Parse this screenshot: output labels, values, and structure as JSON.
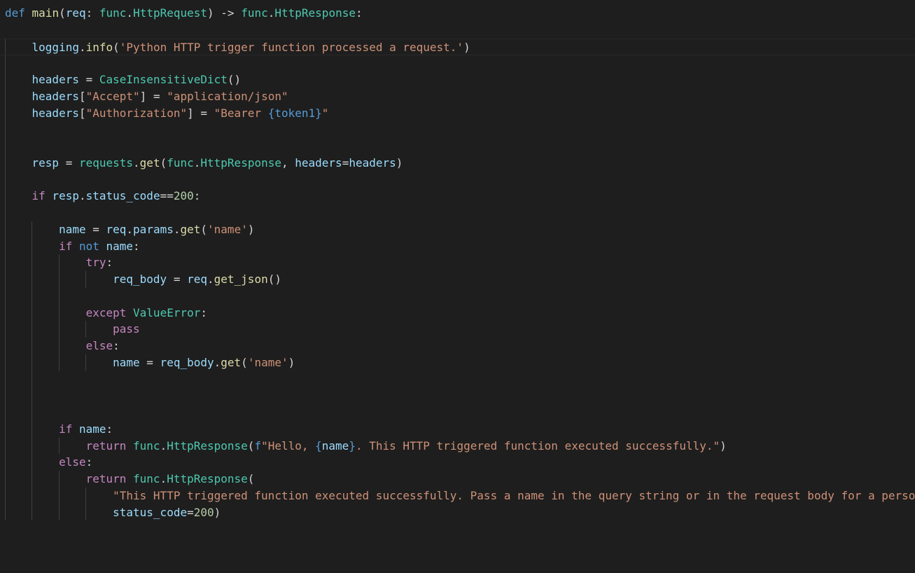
{
  "editor": {
    "language": "python",
    "theme": {
      "background": "#1e1e1e",
      "keyword": "#569cd6",
      "control": "#c586c0",
      "function": "#dcdcaa",
      "variable": "#9cdcfe",
      "string": "#ce9178",
      "number": "#b5cea8",
      "type": "#4ec9b0",
      "default": "#d4d4d4"
    },
    "lines": [
      {
        "indent": 0,
        "current": false,
        "tokens": [
          {
            "t": "def",
            "c": "kw"
          },
          {
            "t": " ",
            "c": "op"
          },
          {
            "t": "main",
            "c": "fn"
          },
          {
            "t": "(",
            "c": "op"
          },
          {
            "t": "req",
            "c": "var"
          },
          {
            "t": ": ",
            "c": "op"
          },
          {
            "t": "func",
            "c": "typ"
          },
          {
            "t": ".",
            "c": "op"
          },
          {
            "t": "HttpRequest",
            "c": "typ"
          },
          {
            "t": ") -> ",
            "c": "op"
          },
          {
            "t": "func",
            "c": "typ"
          },
          {
            "t": ".",
            "c": "op"
          },
          {
            "t": "HttpResponse",
            "c": "typ"
          },
          {
            "t": ":",
            "c": "op"
          }
        ]
      },
      {
        "indent": 0,
        "current": false,
        "tokens": []
      },
      {
        "indent": 1,
        "current": true,
        "tokens": [
          {
            "t": "logging",
            "c": "var"
          },
          {
            "t": ".",
            "c": "op"
          },
          {
            "t": "info",
            "c": "fn"
          },
          {
            "t": "(",
            "c": "op"
          },
          {
            "t": "'Python HTTP trigger function processed a request.'",
            "c": "str"
          },
          {
            "t": ")",
            "c": "op"
          }
        ]
      },
      {
        "indent": 0,
        "current": false,
        "tokens": []
      },
      {
        "indent": 1,
        "current": false,
        "tokens": [
          {
            "t": "headers",
            "c": "var"
          },
          {
            "t": " = ",
            "c": "op"
          },
          {
            "t": "CaseInsensitiveDict",
            "c": "typ"
          },
          {
            "t": "()",
            "c": "op"
          }
        ]
      },
      {
        "indent": 1,
        "current": false,
        "tokens": [
          {
            "t": "headers",
            "c": "var"
          },
          {
            "t": "[",
            "c": "op"
          },
          {
            "t": "\"Accept\"",
            "c": "str"
          },
          {
            "t": "] = ",
            "c": "op"
          },
          {
            "t": "\"application/json\"",
            "c": "str"
          }
        ]
      },
      {
        "indent": 1,
        "current": false,
        "tokens": [
          {
            "t": "headers",
            "c": "var"
          },
          {
            "t": "[",
            "c": "op"
          },
          {
            "t": "\"Authorization\"",
            "c": "str"
          },
          {
            "t": "] = ",
            "c": "op"
          },
          {
            "t": "\"Bearer ",
            "c": "str"
          },
          {
            "t": "{token1}",
            "c": "kw"
          },
          {
            "t": "\"",
            "c": "str"
          }
        ]
      },
      {
        "indent": 0,
        "current": false,
        "tokens": []
      },
      {
        "indent": 0,
        "current": false,
        "tokens": []
      },
      {
        "indent": 1,
        "current": false,
        "tokens": [
          {
            "t": "resp",
            "c": "var"
          },
          {
            "t": " = ",
            "c": "op"
          },
          {
            "t": "requests",
            "c": "typ"
          },
          {
            "t": ".",
            "c": "op"
          },
          {
            "t": "get",
            "c": "fn"
          },
          {
            "t": "(",
            "c": "op"
          },
          {
            "t": "func",
            "c": "typ"
          },
          {
            "t": ".",
            "c": "op"
          },
          {
            "t": "HttpResponse",
            "c": "typ"
          },
          {
            "t": ", ",
            "c": "op"
          },
          {
            "t": "headers",
            "c": "var"
          },
          {
            "t": "=",
            "c": "op"
          },
          {
            "t": "headers",
            "c": "var"
          },
          {
            "t": ")",
            "c": "op"
          }
        ]
      },
      {
        "indent": 0,
        "current": false,
        "tokens": []
      },
      {
        "indent": 1,
        "current": false,
        "tokens": [
          {
            "t": "if",
            "c": "ctl"
          },
          {
            "t": " ",
            "c": "op"
          },
          {
            "t": "resp",
            "c": "var"
          },
          {
            "t": ".",
            "c": "op"
          },
          {
            "t": "status_code",
            "c": "var"
          },
          {
            "t": "==",
            "c": "op"
          },
          {
            "t": "200",
            "c": "num"
          },
          {
            "t": ":",
            "c": "op"
          }
        ]
      },
      {
        "indent": 0,
        "current": false,
        "tokens": []
      },
      {
        "indent": 2,
        "current": false,
        "tokens": [
          {
            "t": "name",
            "c": "var"
          },
          {
            "t": " = ",
            "c": "op"
          },
          {
            "t": "req",
            "c": "var"
          },
          {
            "t": ".",
            "c": "op"
          },
          {
            "t": "params",
            "c": "var"
          },
          {
            "t": ".",
            "c": "op"
          },
          {
            "t": "get",
            "c": "fn"
          },
          {
            "t": "(",
            "c": "op"
          },
          {
            "t": "'name'",
            "c": "str"
          },
          {
            "t": ")",
            "c": "op"
          }
        ]
      },
      {
        "indent": 2,
        "current": false,
        "tokens": [
          {
            "t": "if",
            "c": "ctl"
          },
          {
            "t": " ",
            "c": "op"
          },
          {
            "t": "not",
            "c": "kw"
          },
          {
            "t": " ",
            "c": "op"
          },
          {
            "t": "name",
            "c": "var"
          },
          {
            "t": ":",
            "c": "op"
          }
        ]
      },
      {
        "indent": 3,
        "current": false,
        "tokens": [
          {
            "t": "try",
            "c": "ctl"
          },
          {
            "t": ":",
            "c": "op"
          }
        ]
      },
      {
        "indent": 4,
        "current": false,
        "tokens": [
          {
            "t": "req_body",
            "c": "var"
          },
          {
            "t": " = ",
            "c": "op"
          },
          {
            "t": "req",
            "c": "var"
          },
          {
            "t": ".",
            "c": "op"
          },
          {
            "t": "get_json",
            "c": "fn"
          },
          {
            "t": "()",
            "c": "op"
          }
        ]
      },
      {
        "indent": 0,
        "current": false,
        "tokens": []
      },
      {
        "indent": 3,
        "current": false,
        "tokens": [
          {
            "t": "except",
            "c": "ctl"
          },
          {
            "t": " ",
            "c": "op"
          },
          {
            "t": "ValueError",
            "c": "typ"
          },
          {
            "t": ":",
            "c": "op"
          }
        ]
      },
      {
        "indent": 4,
        "current": false,
        "tokens": [
          {
            "t": "pass",
            "c": "ctl"
          }
        ]
      },
      {
        "indent": 3,
        "current": false,
        "tokens": [
          {
            "t": "else",
            "c": "ctl"
          },
          {
            "t": ":",
            "c": "op"
          }
        ]
      },
      {
        "indent": 4,
        "current": false,
        "tokens": [
          {
            "t": "name",
            "c": "var"
          },
          {
            "t": " = ",
            "c": "op"
          },
          {
            "t": "req_body",
            "c": "var"
          },
          {
            "t": ".",
            "c": "op"
          },
          {
            "t": "get",
            "c": "fn"
          },
          {
            "t": "(",
            "c": "op"
          },
          {
            "t": "'name'",
            "c": "str"
          },
          {
            "t": ")",
            "c": "op"
          }
        ]
      },
      {
        "indent": 0,
        "current": false,
        "tokens": []
      },
      {
        "indent": 0,
        "current": false,
        "tokens": []
      },
      {
        "indent": 0,
        "current": false,
        "tokens": []
      },
      {
        "indent": 2,
        "current": false,
        "tokens": [
          {
            "t": "if",
            "c": "ctl"
          },
          {
            "t": " ",
            "c": "op"
          },
          {
            "t": "name",
            "c": "var"
          },
          {
            "t": ":",
            "c": "op"
          }
        ]
      },
      {
        "indent": 3,
        "current": false,
        "tokens": [
          {
            "t": "return",
            "c": "ctl"
          },
          {
            "t": " ",
            "c": "op"
          },
          {
            "t": "func",
            "c": "typ"
          },
          {
            "t": ".",
            "c": "op"
          },
          {
            "t": "HttpResponse",
            "c": "typ"
          },
          {
            "t": "(",
            "c": "op"
          },
          {
            "t": "f",
            "c": "kw"
          },
          {
            "t": "\"Hello, ",
            "c": "str"
          },
          {
            "t": "{",
            "c": "kw"
          },
          {
            "t": "name",
            "c": "var"
          },
          {
            "t": "}",
            "c": "kw"
          },
          {
            "t": ". This HTTP triggered function executed successfully.\"",
            "c": "str"
          },
          {
            "t": ")",
            "c": "op"
          }
        ]
      },
      {
        "indent": 2,
        "current": false,
        "tokens": [
          {
            "t": "else",
            "c": "ctl"
          },
          {
            "t": ":",
            "c": "op"
          }
        ]
      },
      {
        "indent": 3,
        "current": false,
        "tokens": [
          {
            "t": "return",
            "c": "ctl"
          },
          {
            "t": " ",
            "c": "op"
          },
          {
            "t": "func",
            "c": "typ"
          },
          {
            "t": ".",
            "c": "op"
          },
          {
            "t": "HttpResponse",
            "c": "typ"
          },
          {
            "t": "(",
            "c": "op"
          }
        ]
      },
      {
        "indent": 4,
        "current": false,
        "tokens": [
          {
            "t": "\"This HTTP triggered function executed successfully. Pass a name in the query string or in the request body for a perso",
            "c": "str"
          }
        ]
      },
      {
        "indent": 4,
        "current": false,
        "tokens": [
          {
            "t": "status_code",
            "c": "var"
          },
          {
            "t": "=",
            "c": "op"
          },
          {
            "t": "200",
            "c": "num"
          },
          {
            "t": ")",
            "c": "op"
          }
        ]
      }
    ]
  }
}
